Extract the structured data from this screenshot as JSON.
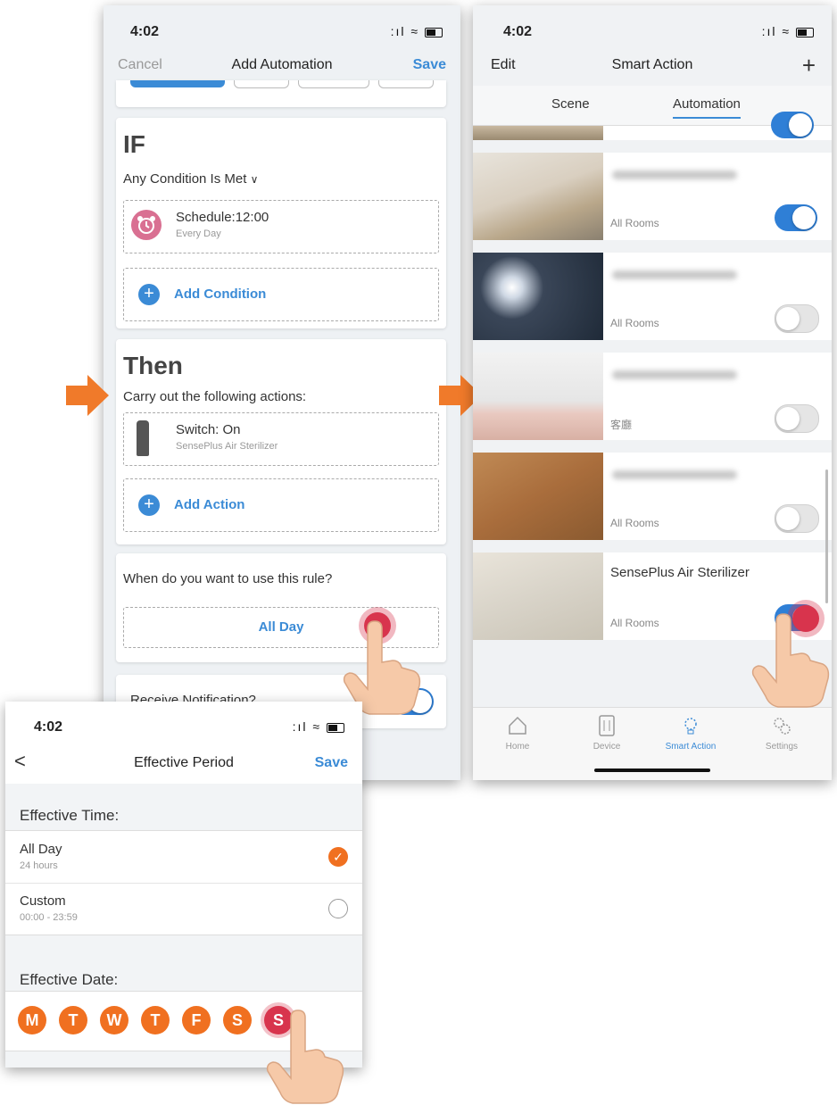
{
  "status_time": "4:02",
  "add_automation": {
    "cancel": "Cancel",
    "title": "Add Automation",
    "save": "Save",
    "if_heading": "IF",
    "condition_mode": "Any Condition Is Met",
    "schedule_title": "Schedule:12:00",
    "schedule_sub": "Every Day",
    "add_condition": "Add Condition",
    "then_heading": "Then",
    "then_sub": "Carry out the following actions:",
    "action_title": "Switch: On",
    "action_sub": "SensePlus Air Sterilizer",
    "add_action": "Add Action",
    "rule_question": "When do you want to use this rule?",
    "rule_value": "All Day",
    "notification": "Receive Notification?"
  },
  "smart_action": {
    "edit": "Edit",
    "title": "Smart Action",
    "add": "+",
    "tabs": [
      "Scene",
      "Automation"
    ],
    "active_tab": "Automation",
    "items": [
      {
        "title": "",
        "room": "All Rooms",
        "on": true,
        "scene": "living-room"
      },
      {
        "title": "",
        "room": "All Rooms",
        "on": false,
        "scene": "bulbs"
      },
      {
        "title": "",
        "room": "客廳",
        "on": false,
        "scene": "bedroom"
      },
      {
        "title": "",
        "room": "All Rooms",
        "on": false,
        "scene": "desk"
      },
      {
        "title": "SensePlus Air Sterilizer",
        "room": "All Rooms",
        "on": true,
        "scene": "plate"
      }
    ],
    "bottom_tabs": [
      "Home",
      "Device",
      "Smart Action",
      "Settings"
    ],
    "active_bottom_tab": "Smart Action"
  },
  "effective_period": {
    "back": "<",
    "title": "Effective Period",
    "save": "Save",
    "time_heading": "Effective Time:",
    "options": [
      {
        "label": "All Day",
        "sub": "24 hours",
        "checked": true
      },
      {
        "label": "Custom",
        "sub": "00:00 - 23:59",
        "checked": false
      }
    ],
    "date_heading": "Effective Date:",
    "days": [
      "M",
      "T",
      "W",
      "T",
      "F",
      "S",
      "S"
    ]
  },
  "colors": {
    "accent_blue": "#3b8bd6",
    "accent_orange": "#f07020",
    "tap_red": "#d8344d"
  }
}
